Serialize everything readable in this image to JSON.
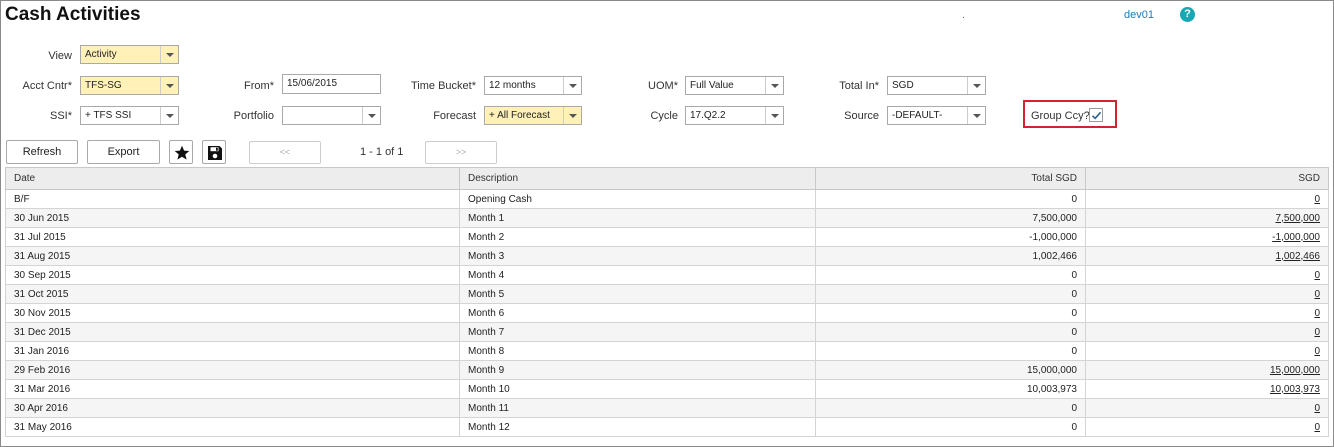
{
  "header": {
    "title": "Cash Activities",
    "separator": ".",
    "user": "dev01",
    "help_symbol": "?"
  },
  "filters": {
    "view": {
      "label": "View",
      "value": "Activity"
    },
    "acct_cntr": {
      "label": "Acct Cntr*",
      "value": "TFS-SG"
    },
    "ssi": {
      "label": "SSI*",
      "value": "+ TFS SSI"
    },
    "from": {
      "label": "From*",
      "value": "15/06/2015"
    },
    "portfolio": {
      "label": "Portfolio",
      "value": ""
    },
    "time_bucket": {
      "label": "Time Bucket*",
      "value": "12 months"
    },
    "forecast": {
      "label": "Forecast",
      "value": "+ All Forecast"
    },
    "uom": {
      "label": "UOM*",
      "value": "Full Value"
    },
    "cycle": {
      "label": "Cycle",
      "value": "17.Q2.2"
    },
    "total_in": {
      "label": "Total In*",
      "value": "SGD"
    },
    "source": {
      "label": "Source",
      "value": "-DEFAULT-"
    },
    "group_ccy": {
      "label": "Group Ccy?",
      "checked": true
    }
  },
  "toolbar": {
    "refresh_label": "Refresh",
    "export_label": "Export",
    "prev_label": "<<",
    "next_label": ">>",
    "page_info": "1 - 1 of 1"
  },
  "table": {
    "columns": [
      "Date",
      "Description",
      "Total SGD",
      "SGD"
    ],
    "rows": [
      {
        "date": "B/F",
        "desc": "Opening Cash",
        "total": "0",
        "sgd": "0",
        "neg": false
      },
      {
        "date": "30 Jun 2015",
        "desc": "Month 1",
        "total": "7,500,000",
        "sgd": "7,500,000",
        "neg": false
      },
      {
        "date": "31 Jul 2015",
        "desc": "Month 2",
        "total": "-1,000,000",
        "sgd": "-1,000,000",
        "neg": true
      },
      {
        "date": "31 Aug 2015",
        "desc": "Month 3",
        "total": "1,002,466",
        "sgd": "1,002,466",
        "neg": false
      },
      {
        "date": "30 Sep 2015",
        "desc": "Month 4",
        "total": "0",
        "sgd": "0",
        "neg": false
      },
      {
        "date": "31 Oct 2015",
        "desc": "Month 5",
        "total": "0",
        "sgd": "0",
        "neg": false
      },
      {
        "date": "30 Nov 2015",
        "desc": "Month 6",
        "total": "0",
        "sgd": "0",
        "neg": false
      },
      {
        "date": "31 Dec 2015",
        "desc": "Month 7",
        "total": "0",
        "sgd": "0",
        "neg": false
      },
      {
        "date": "31 Jan 2016",
        "desc": "Month 8",
        "total": "0",
        "sgd": "0",
        "neg": false
      },
      {
        "date": "29 Feb 2016",
        "desc": "Month 9",
        "total": "15,000,000",
        "sgd": "15,000,000",
        "neg": false
      },
      {
        "date": "31 Mar 2016",
        "desc": "Month 10",
        "total": "10,003,973",
        "sgd": "10,003,973",
        "neg": false
      },
      {
        "date": "30 Apr 2016",
        "desc": "Month 11",
        "total": "0",
        "sgd": "0",
        "neg": false
      },
      {
        "date": "31 May 2016",
        "desc": "Month 12",
        "total": "0",
        "sgd": "0",
        "neg": false
      }
    ]
  },
  "colors": {
    "positive": "#1f2d9e",
    "negative": "#c41b1b",
    "required_field": "#fff1b8",
    "highlight_box": "#d9202e",
    "help_icon": "#17a8b4"
  },
  "icons": {
    "favorite": "star-icon",
    "save": "floppy-disk-icon",
    "help": "help-icon",
    "check": "check-icon",
    "dropdown": "chevron-down-icon"
  }
}
